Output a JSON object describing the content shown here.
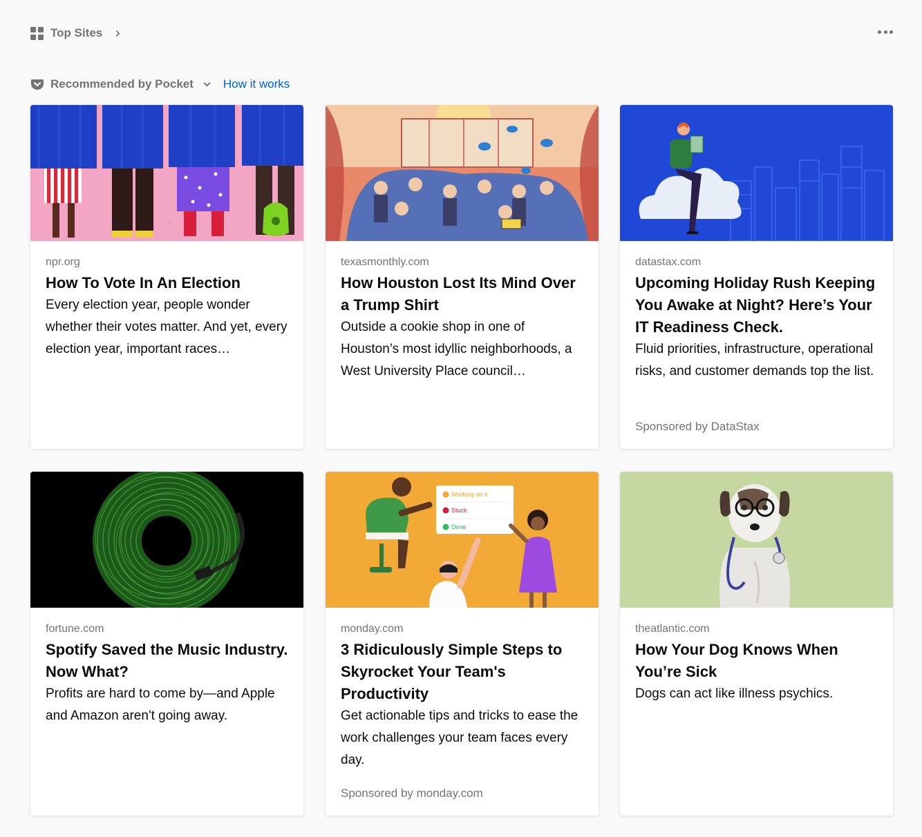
{
  "top_sites": {
    "label": "Top Sites",
    "icon": "grid-icon",
    "more_icon": "ellipsis-icon"
  },
  "pocket": {
    "label": "Recommended by Pocket",
    "link": "How it works",
    "link_color": "#0060df",
    "icon": "pocket-icon"
  },
  "cards": [
    {
      "source": "npr.org",
      "title": "How To Vote In An Election",
      "excerpt": "Every election year, people wonder whether their votes matter. And yet, every election year, important races…",
      "sponsor": ""
    },
    {
      "source": "texasmonthly.com",
      "title": "How Houston Lost Its Mind Over a Trump Shirt",
      "excerpt": "Outside a cookie shop in one of Houston’s most idyllic neighborhoods, a West University Place council…",
      "sponsor": ""
    },
    {
      "source": "datastax.com",
      "title": "Upcoming Holiday Rush Keeping You Awake at Night? Here’s Your IT Readiness Check.",
      "excerpt": "Fluid priorities, infrastructure, operational risks, and customer demands top the list.",
      "sponsor": "Sponsored by DataStax"
    },
    {
      "source": "fortune.com",
      "title": "Spotify Saved the Music Industry. Now What?",
      "excerpt": "Profits are hard to come by—and Apple and Amazon aren't going away.",
      "sponsor": ""
    },
    {
      "source": "monday.com",
      "title": "3 Ridiculously Simple Steps to Skyrocket Your Team's Productivity",
      "excerpt": "Get actionable tips and tricks to ease the work challenges your team faces every day.",
      "sponsor": "Sponsored by monday.com",
      "image_labels": [
        "Working on it",
        "Stuck",
        "Done"
      ]
    },
    {
      "source": "theatlantic.com",
      "title": "How Your Dog Knows When You’re Sick",
      "excerpt": "Dogs can act like illness psychics.",
      "sponsor": ""
    }
  ]
}
